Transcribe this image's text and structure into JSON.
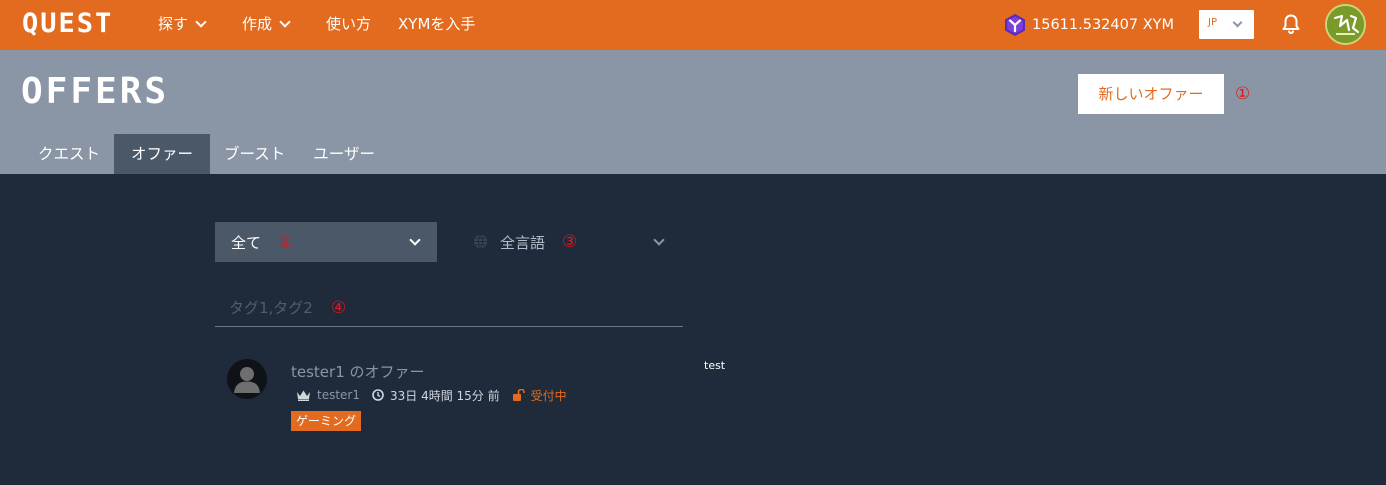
{
  "app": {
    "logo": "QUEST",
    "nav": [
      {
        "label": "探す",
        "has_dropdown": true
      },
      {
        "label": "作成",
        "has_dropdown": true
      },
      {
        "label": "使い方",
        "has_dropdown": false
      },
      {
        "label": "XYMを入手",
        "has_dropdown": false
      }
    ],
    "balance": "15611.532407 XYM",
    "language": "JP",
    "icons": {
      "balance": "symbol-logo-icon",
      "notifications": "bell-icon",
      "user": "avatar"
    }
  },
  "header": {
    "title": "OFFERS",
    "new_offer_button": "新しいオファー",
    "tabs": [
      {
        "label": "クエスト",
        "active": false
      },
      {
        "label": "オファー",
        "active": true
      },
      {
        "label": "ブースト",
        "active": false
      },
      {
        "label": "ユーザー",
        "active": false
      }
    ]
  },
  "filters": {
    "category": "全て",
    "language": "全言語",
    "tags_placeholder": "タグ1,タグ2"
  },
  "markers": [
    "①",
    "②",
    "③",
    "④"
  ],
  "offers": [
    {
      "title": "tester1 のオファー",
      "owner": "tester1",
      "time": "33日 4時間 15分 前",
      "status": "受付中",
      "tag": "ゲーミング",
      "body": "test"
    }
  ],
  "colors": {
    "accent": "#e26b1f",
    "header_bg": "#8a96a6",
    "page_bg": "#1f2b3a",
    "marker": "#e0161d"
  }
}
